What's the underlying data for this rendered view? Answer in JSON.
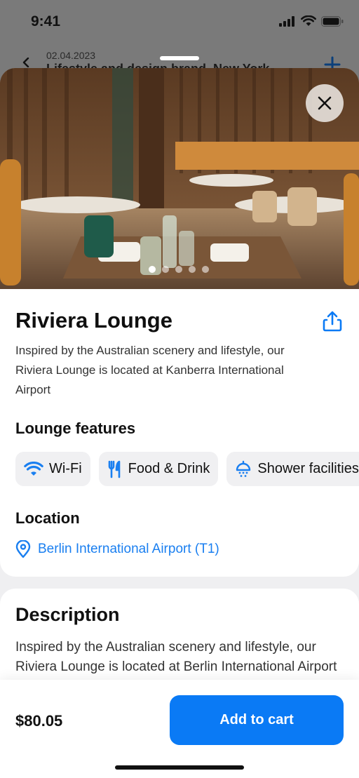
{
  "status_bar": {
    "time": "9:41"
  },
  "background_screen": {
    "date": "02.04.2023",
    "title": "Lifestyle and design brand, New York"
  },
  "hero": {
    "image_description": "restaurant-lounge-photo",
    "page_count": 5,
    "active_page": 1
  },
  "lounge": {
    "name": "Riviera Lounge",
    "summary": "Inspired by the Australian scenery and lifestyle, our Riviera Lounge is located at Kanberra International Airport",
    "features_heading": "Lounge features",
    "features": [
      {
        "icon": "wifi-icon",
        "label": "Wi-Fi"
      },
      {
        "icon": "fork-knife-icon",
        "label": "Food & Drink"
      },
      {
        "icon": "shower-icon",
        "label": "Shower facilities"
      }
    ],
    "location_heading": "Location",
    "location": "Berlin International Airport (T1)"
  },
  "description": {
    "heading": "Description",
    "text": "Inspired by the Australian scenery and lifestyle, our Riviera Lounge is located at Berlin International Airport"
  },
  "checkout": {
    "price": "$80.05",
    "button_label": "Add to cart"
  },
  "colors": {
    "accent": "#0a7af5",
    "link": "#1a7ff0",
    "chip_bg": "#f0f0f2"
  }
}
